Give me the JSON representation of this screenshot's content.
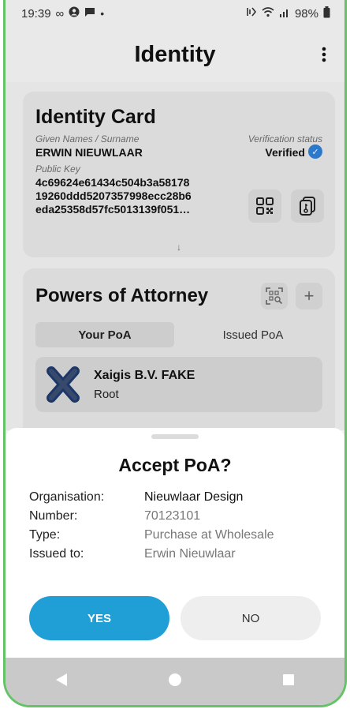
{
  "status_bar": {
    "time": "19:39",
    "battery": "98%"
  },
  "header": {
    "title": "Identity"
  },
  "identity_card": {
    "title": "Identity Card",
    "name_label": "Given Names / Surname",
    "name_value": "ERWIN NIEUWLAAR",
    "status_label": "Verification status",
    "status_value": "Verified",
    "public_key_label": "Public Key",
    "public_key": "4c69624e61434c504b3a58178 19260ddd5207357998ecc28b6 eda25358d57fc5013139f051…",
    "more_indicator": "↓"
  },
  "poa": {
    "title": "Powers of Attorney",
    "add_label": "+",
    "tabs": [
      {
        "label": "Your PoA"
      },
      {
        "label": "Issued PoA"
      }
    ],
    "items": [
      {
        "name": "Xaigis B.V. FAKE",
        "role": "Root"
      }
    ]
  },
  "sheet": {
    "title": "Accept PoA?",
    "rows": [
      {
        "label": "Organisation:",
        "value": "Nieuwlaar Design"
      },
      {
        "label": "Number:",
        "value": "70123101"
      },
      {
        "label": "Type:",
        "value": "Purchase at Wholesale"
      },
      {
        "label": "Issued to:",
        "value": "Erwin Nieuwlaar"
      }
    ],
    "yes_label": "YES",
    "no_label": "NO"
  },
  "colors": {
    "accent": "#1f9fd6",
    "verified": "#2f7fd6",
    "frame": "#66c266"
  }
}
